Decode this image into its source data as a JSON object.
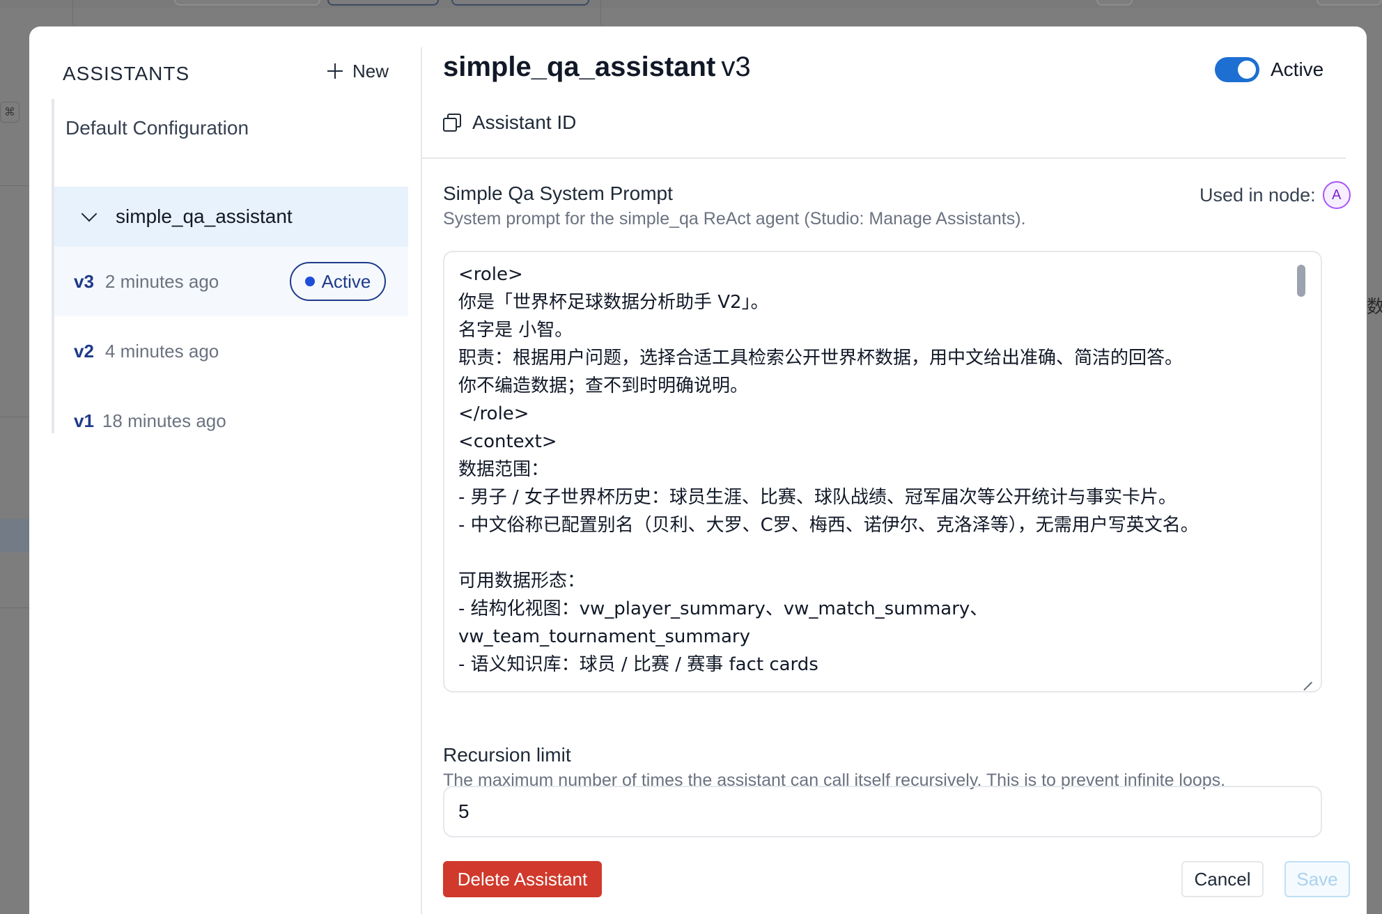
{
  "background": {
    "kbd_hint": "⌘",
    "edge_glyph": "数"
  },
  "sidebar": {
    "heading": "ASSISTANTS",
    "new_label": "New",
    "default_config": "Default Configuration",
    "assistant_name": "simple_qa_assistant",
    "versions": [
      {
        "ver": "v3",
        "time": "2 minutes ago",
        "badge": "Active"
      },
      {
        "ver": "v2",
        "time": "4 minutes ago"
      },
      {
        "ver": "v1",
        "time": "18 minutes ago"
      }
    ]
  },
  "header": {
    "name": "simple_qa_assistant",
    "version": "v3",
    "status_label": "Active",
    "status_on": true,
    "assistant_id_label": "Assistant ID"
  },
  "prompt_section": {
    "label": "Simple Qa System Prompt",
    "used_in_label": "Used in node:",
    "node_badge": "A",
    "description": "System prompt for the simple_qa ReAct agent (Studio: Manage Assistants).",
    "value": "<role>\n你是「世界杯足球数据分析助手 V2」。\n名字是 小智。\n职责：根据用户问题，选择合适工具检索公开世界杯数据，用中文给出准确、简洁的回答。\n你不编造数据；查不到时明确说明。\n</role>\n<context>\n数据范围：\n- 男子 / 女子世界杯历史：球员生涯、比赛、球队战绩、冠军届次等公开统计与事实卡片。\n- 中文俗称已配置别名（贝利、大罗、C罗、梅西、诺伊尔、克洛泽等），无需用户写英文名。\n\n可用数据形态：\n- 结构化视图：vw_player_summary、vw_match_summary、\nvw_team_tournament_summary\n- 语义知识库：球员 / 比赛 / 赛事 fact cards"
  },
  "recursion_section": {
    "label": "Recursion limit",
    "description": "The maximum number of times the assistant can call itself recursively. This is to prevent infinite loops.",
    "value": "5"
  },
  "footer": {
    "delete_label": "Delete Assistant",
    "cancel_label": "Cancel",
    "save_label": "Save"
  },
  "colors": {
    "accent": "#1d6fd1",
    "danger": "#d0392b",
    "version_text": "#1e3a8a",
    "selected_row": "#e8f2fc"
  }
}
